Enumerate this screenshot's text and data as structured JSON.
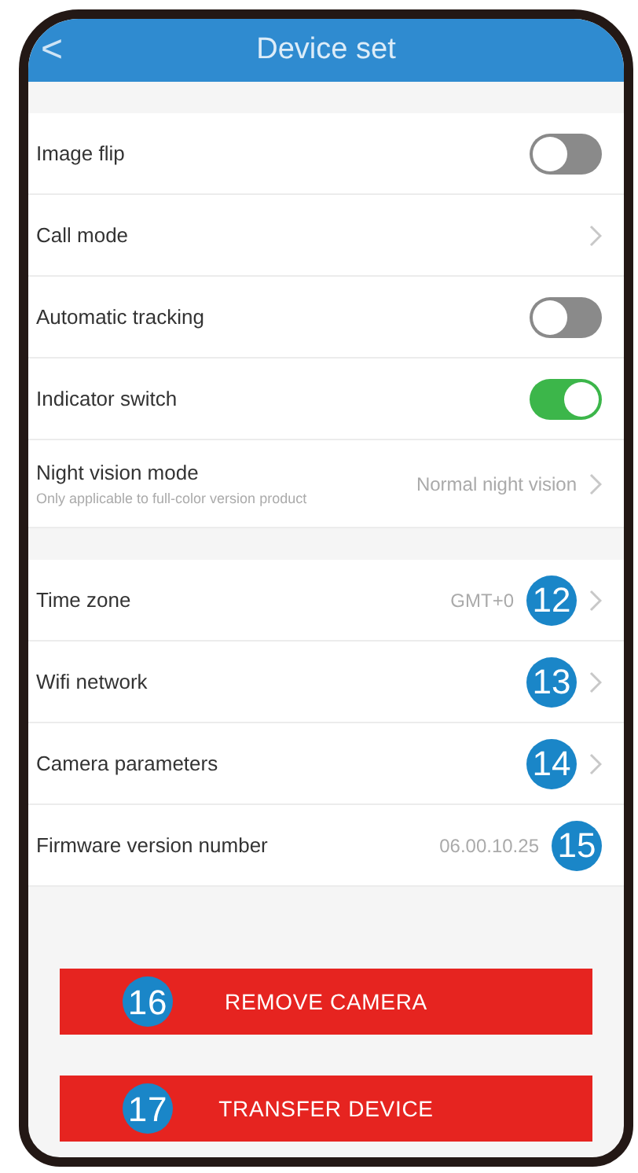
{
  "header": {
    "back": "<",
    "title": "Device set"
  },
  "groups": [
    {
      "rows": [
        {
          "kind": "toggle",
          "label": "Image flip",
          "on": false
        },
        {
          "kind": "link",
          "label": "Call mode"
        },
        {
          "kind": "toggle",
          "label": "Automatic tracking",
          "on": false
        },
        {
          "kind": "toggle",
          "label": "Indicator switch",
          "on": true
        },
        {
          "kind": "link",
          "label": "Night vision mode",
          "subtitle": "Only applicable to full-color version product",
          "value": "Normal night vision"
        }
      ]
    },
    {
      "rows": [
        {
          "kind": "link",
          "label": "Time zone",
          "value": "GMT+0",
          "callout": "12"
        },
        {
          "kind": "link",
          "label": "Wifi network",
          "callout": "13"
        },
        {
          "kind": "link",
          "label": "Camera parameters",
          "callout": "14"
        },
        {
          "kind": "info",
          "label": "Firmware version number",
          "value": "06.00.10.25",
          "callout": "15"
        }
      ]
    }
  ],
  "buttons": [
    {
      "label": "REMOVE CAMERA",
      "callout": "16"
    },
    {
      "label": "TRANSFER DEVICE",
      "callout": "17"
    }
  ]
}
